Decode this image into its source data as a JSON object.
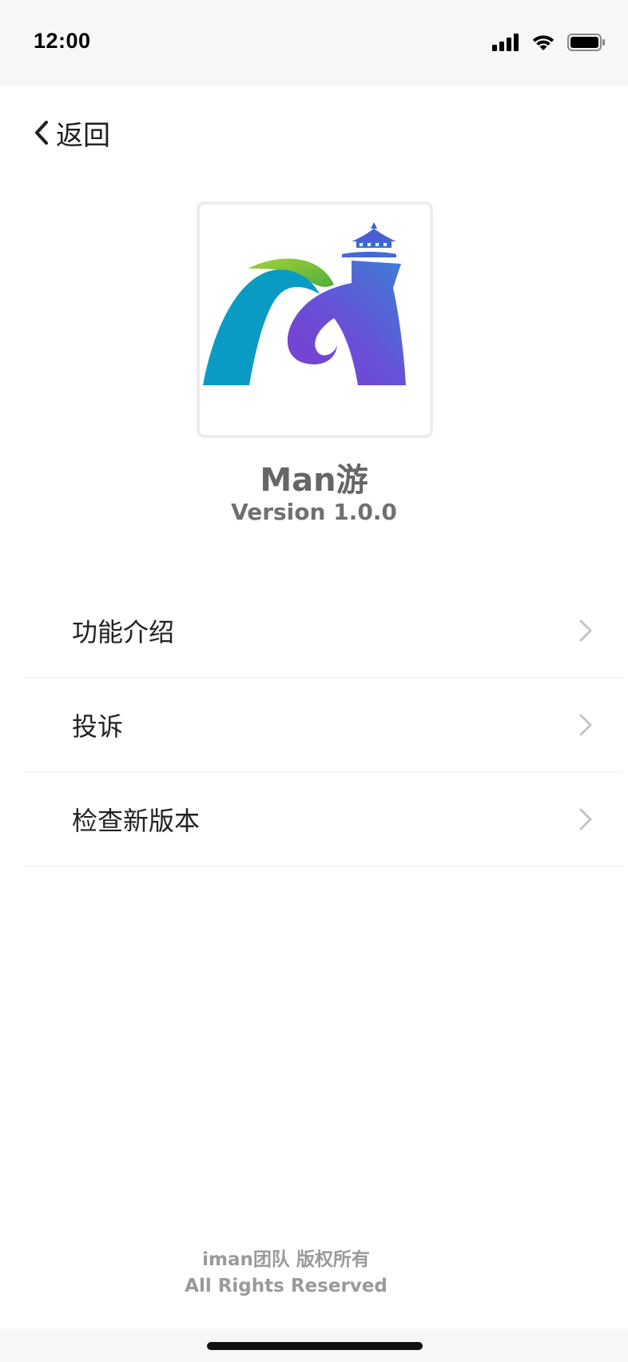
{
  "status_bar": {
    "time": "12:00",
    "icons": [
      "signal-icon",
      "wifi-icon",
      "battery-icon"
    ]
  },
  "nav": {
    "back_label": "返回",
    "back_icon": "chevron-left-icon"
  },
  "app": {
    "logo": "app-logo-icon",
    "name": "Man游",
    "version": "Version 1.0.0"
  },
  "menu": {
    "items": [
      {
        "label": "功能介绍",
        "icon": "chevron-right-icon"
      },
      {
        "label": "投诉",
        "icon": "chevron-right-icon"
      },
      {
        "label": "检查新版本",
        "icon": "chevron-right-icon"
      }
    ]
  },
  "footer": {
    "line1": "iman团队 版权所有",
    "line2": "All Rights Reserved"
  },
  "colors": {
    "status_bar_bg": "#f7f7f7",
    "logo_teal": "#0a9bc4",
    "logo_green": "#8cc63f",
    "logo_purple": "#7b3fd0",
    "logo_blue": "#3d7fd6",
    "text_gray": "#666666"
  }
}
